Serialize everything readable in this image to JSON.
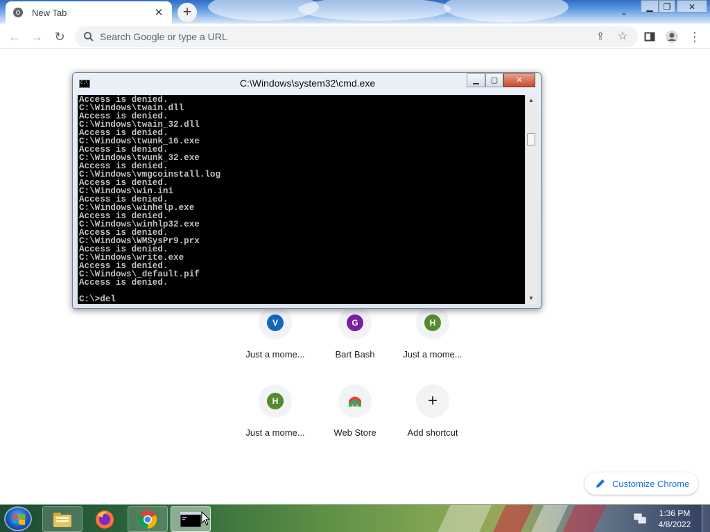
{
  "browser": {
    "tab_title": "New Tab",
    "tab_close_icon": "close-icon",
    "new_tab_icon": "plus-icon",
    "omnibox_placeholder": "Search Google or type a URL",
    "toolbar_icons": [
      "back-arrow-icon",
      "forward-arrow-icon",
      "reload-icon",
      "share-icon",
      "star-icon",
      "side-panel-icon",
      "profile-icon",
      "menu-icon"
    ]
  },
  "cmd": {
    "title": "C:\\Windows\\system32\\cmd.exe",
    "lines": [
      "Access is denied.",
      "C:\\Windows\\twain.dll",
      "Access is denied.",
      "C:\\Windows\\twain_32.dll",
      "Access is denied.",
      "C:\\Windows\\twunk_16.exe",
      "Access is denied.",
      "C:\\Windows\\twunk_32.exe",
      "Access is denied.",
      "C:\\Windows\\vmgcoinstall.log",
      "Access is denied.",
      "C:\\Windows\\win.ini",
      "Access is denied.",
      "C:\\Windows\\winhelp.exe",
      "Access is denied.",
      "C:\\Windows\\winhlp32.exe",
      "Access is denied.",
      "C:\\Windows\\WMSysPr9.prx",
      "Access is denied.",
      "C:\\Windows\\write.exe",
      "Access is denied.",
      "C:\\Windows\\_default.pif",
      "Access is denied.",
      "",
      "C:\\>del"
    ]
  },
  "shortcuts": {
    "row1": [
      {
        "letter": "V",
        "label": "Just a mome...",
        "color": "#1565c0"
      },
      {
        "letter": "G",
        "label": "Bart Bash",
        "color": "#7b1fa2"
      },
      {
        "letter": "H",
        "label": "Just a mome...",
        "color": "#558b2f"
      }
    ],
    "row2": [
      {
        "letter": "H",
        "label": "Just a mome...",
        "color": "#558b2f"
      },
      {
        "letter": "",
        "label": "Web Store",
        "icon": "web-store-icon"
      },
      {
        "letter": "+",
        "label": "Add shortcut",
        "icon": "plus-icon"
      }
    ]
  },
  "customize": {
    "label": "Customize Chrome",
    "icon": "pencil-icon",
    "color": "#1a73e8"
  },
  "taskbar": {
    "apps": [
      "windows-explorer-icon",
      "firefox-icon",
      "chrome-icon",
      "cmd-icon"
    ],
    "time": "1:36 PM",
    "date": "4/8/2022"
  }
}
